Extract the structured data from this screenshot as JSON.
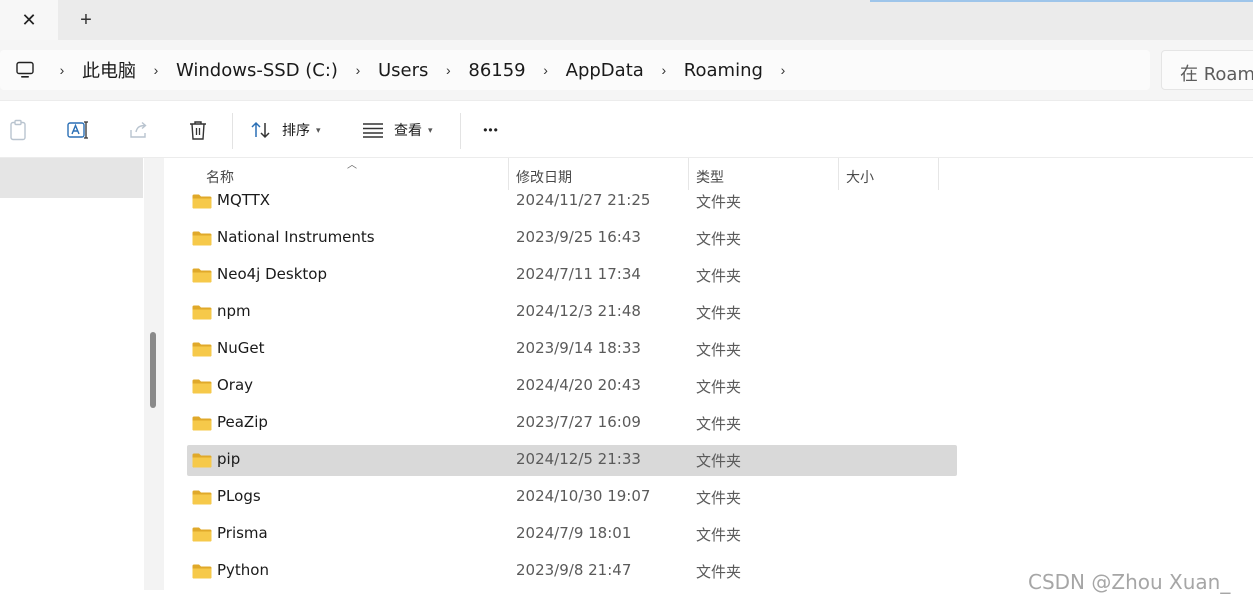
{
  "tabs": {
    "close_glyph": "✕",
    "new_tab_glyph": "+"
  },
  "address": {
    "root_icon": "computer-icon",
    "separator": "›",
    "crumbs": [
      "此电脑",
      "Windows-SSD (C:)",
      "Users",
      "86159",
      "AppData",
      "Roaming"
    ],
    "search_placeholder": "在 Roaming"
  },
  "commandbar": {
    "paste_icon": "clipboard-icon",
    "rename_icon": "rename-icon",
    "share_icon": "share-icon",
    "delete_icon": "trash-icon",
    "sort_label": "排序",
    "view_label": "查看",
    "more_glyph": "•••"
  },
  "columns": {
    "name": "名称",
    "date": "修改日期",
    "type": "类型",
    "size": "大小"
  },
  "files": [
    {
      "name": "MQTTX",
      "date": "2024/11/27 21:25",
      "type": "文件夹",
      "size": ""
    },
    {
      "name": "National Instruments",
      "date": "2023/9/25 16:43",
      "type": "文件夹",
      "size": ""
    },
    {
      "name": "Neo4j Desktop",
      "date": "2024/7/11 17:34",
      "type": "文件夹",
      "size": ""
    },
    {
      "name": "npm",
      "date": "2024/12/3 21:48",
      "type": "文件夹",
      "size": ""
    },
    {
      "name": "NuGet",
      "date": "2023/9/14 18:33",
      "type": "文件夹",
      "size": ""
    },
    {
      "name": "Oray",
      "date": "2024/4/20 20:43",
      "type": "文件夹",
      "size": ""
    },
    {
      "name": "PeaZip",
      "date": "2023/7/27 16:09",
      "type": "文件夹",
      "size": ""
    },
    {
      "name": "pip",
      "date": "2024/12/5 21:33",
      "type": "文件夹",
      "size": "",
      "selected": true
    },
    {
      "name": "PLogs",
      "date": "2024/10/30 19:07",
      "type": "文件夹",
      "size": ""
    },
    {
      "name": "Prisma",
      "date": "2024/7/9 18:01",
      "type": "文件夹",
      "size": ""
    },
    {
      "name": "Python",
      "date": "2023/9/8 21:47",
      "type": "文件夹",
      "size": ""
    }
  ],
  "watermark": "CSDN @Zhou  Xuan_",
  "colors": {
    "folder": "#f6c94a",
    "folder_dark": "#e0a92a",
    "selected_row": "#d9d9d9",
    "accent": "#9ec5ea"
  }
}
